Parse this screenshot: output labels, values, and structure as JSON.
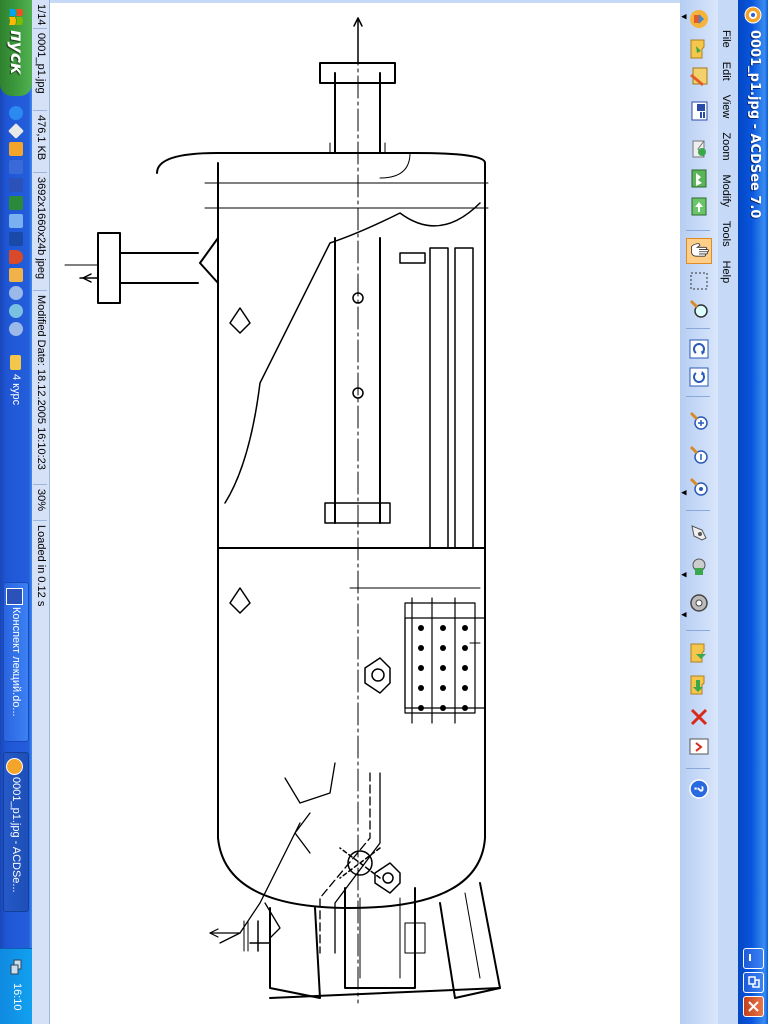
{
  "window": {
    "title": "0001_p1.jpg - ACDSee 7.0"
  },
  "menu": [
    "File",
    "Edit",
    "View",
    "Zoom",
    "Modify",
    "Tools",
    "Help"
  ],
  "toolbar": {
    "buttons": [
      "browse-icon",
      "open-icon",
      "edit-icon",
      "slideshow-icon",
      "email-icon",
      "acquire-icon",
      "web-icon",
      "hand-tool-icon",
      "select-tool-icon",
      "zoom-tool-icon",
      "rotate-left-icon",
      "rotate-right-icon",
      "zoom-in-icon",
      "zoom-out-icon",
      "zoom-fit-icon",
      "filter-icon",
      "wallpaper-icon",
      "cd-icon",
      "copy-to-icon",
      "move-to-icon",
      "delete-icon",
      "properties-icon",
      "help-icon"
    ],
    "active": "hand-tool-icon"
  },
  "status": {
    "index": "1/14",
    "filename": "0001_p1.jpg",
    "filesize": "476,1 KB",
    "dimensions": "3692x1660x24b jpeg",
    "modified": "Modified Date: 18.12.2005 16:10:23",
    "zoom": "30%",
    "loaded": "Loaded in 0.12 s"
  },
  "taskbar": {
    "start_label": "пуск",
    "folder_label": "4 курс",
    "tasks": [
      {
        "label": "Конспект лекций.do...",
        "active": false
      },
      {
        "label": "0001_p1.jpg - ACDSe...",
        "active": true
      }
    ],
    "clock": "16:10"
  },
  "colors": {
    "titlebar": "#0855dd",
    "menubar": "#c6d9f7",
    "taskbar": "#245edb",
    "start": "#3c9a3c",
    "tray": "#12a0f0"
  }
}
